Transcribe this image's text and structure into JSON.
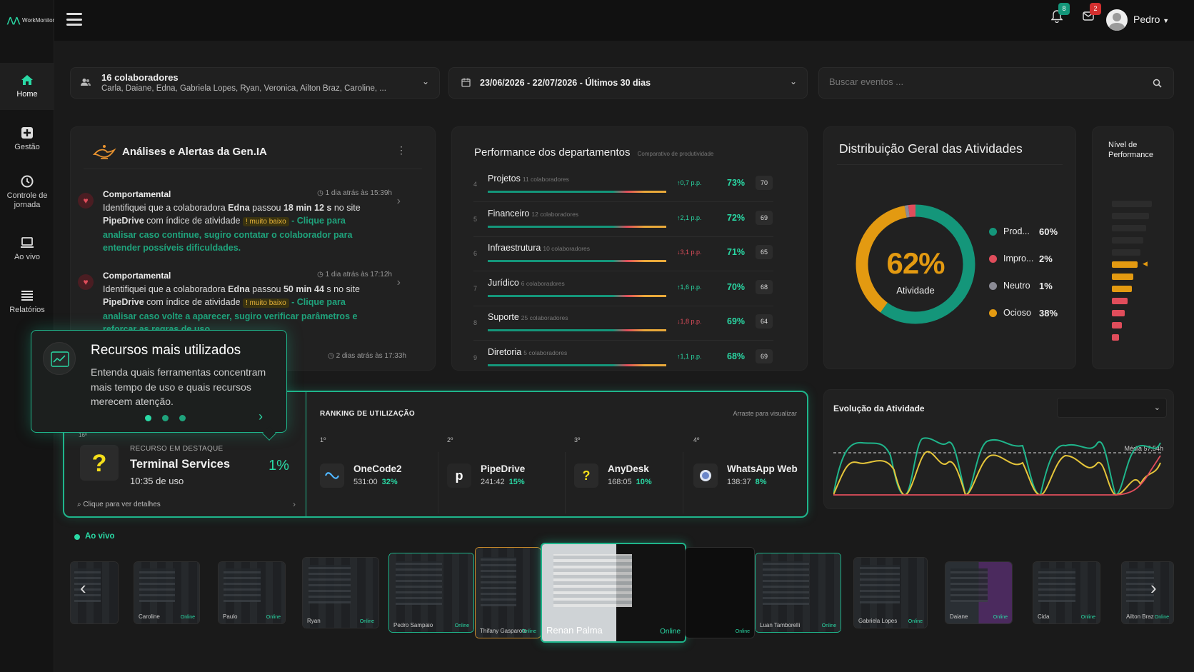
{
  "app": {
    "logo_text": "WorkMonitor"
  },
  "colors": {
    "accent": "#2ad9a5",
    "danger": "#e04d5b",
    "warning": "#e9a93a",
    "neutral": "#8b8b95"
  },
  "sidebar": {
    "items": [
      {
        "label": "Home",
        "icon": "home-icon"
      },
      {
        "label": "Gestão",
        "icon": "plus-square-icon"
      },
      {
        "label": "Controle de jornada",
        "icon": "clock-icon"
      },
      {
        "label": "Ao vivo",
        "icon": "monitor-icon"
      },
      {
        "label": "Relatórios",
        "icon": "list-icon"
      }
    ]
  },
  "header": {
    "notifications_count": "8",
    "messages_count": "2",
    "user_name": "Pedro"
  },
  "filters": {
    "collaborators_title": "16 colaboradores",
    "collaborators_names": "Carla, Daiane, Edna, Gabriela Lopes, Ryan, Veronica, Ailton Braz, Caroline, ...",
    "date_range": "23/06/2026 - 22/07/2026 - Últimos 30 dias",
    "search_placeholder": "Buscar eventos ..."
  },
  "alerts": {
    "title": "Análises e Alertas da Gen.IA",
    "items": [
      {
        "type": "Comportamental",
        "time": "1 dia atrás às 15:39h",
        "text_pre": "Identifiquei que a colaboradora ",
        "name": "Edna",
        "text_mid": " passou ",
        "duration": "18 min 12 s",
        "text_post": " no site",
        "site": "PipeDrive",
        "text_idx": " com índice de atividade ",
        "level": "muito baixo",
        "cta": " - Clique para analisar caso continue, sugiro contatar o colaborador para entender possíveis dificuldades."
      },
      {
        "type": "Comportamental",
        "time": "1 dia atrás às 17:12h",
        "text_pre": "Identifiquei que a colaboradora ",
        "name": "Edna",
        "text_mid": " passou ",
        "duration": "50 min 44",
        "text_post": " s no site",
        "site": "PipeDrive",
        "text_idx": " com índice de atividade ",
        "level": "muito baixo",
        "cta": " - Clique para analisar caso volte a aparecer, sugiro verificar parâmetros e reforçar as regras de uso."
      }
    ],
    "third_time": "2 dias atrás às 17:33h"
  },
  "tooltip": {
    "title": "Recursos mais utilizados",
    "text": "Entenda quais ferramentas concentram mais tempo de uso e quais recursos merecem atenção."
  },
  "departments": {
    "title": "Performance dos departamentos",
    "subtitle": "Comparativo de produtividade",
    "rows": [
      {
        "idx": "4",
        "name": "Projetos",
        "sub": "11 colaboradores",
        "change": "↑0,7 p.p.",
        "dir": "up",
        "pct": "73%",
        "score": "70"
      },
      {
        "idx": "5",
        "name": "Financeiro",
        "sub": "12 colaboradores",
        "change": "↑2,1 p.p.",
        "dir": "up",
        "pct": "72%",
        "score": "69"
      },
      {
        "idx": "6",
        "name": "Infraestrutura",
        "sub": "10 colaboradores",
        "change": "↓3,1 p.p.",
        "dir": "down",
        "pct": "71%",
        "score": "65"
      },
      {
        "idx": "7",
        "name": "Jurídico",
        "sub": "6 colaboradores",
        "change": "↑1,6 p.p.",
        "dir": "up",
        "pct": "70%",
        "score": "68"
      },
      {
        "idx": "8",
        "name": "Suporte",
        "sub": "25 colaboradores",
        "change": "↓1,8 p.p.",
        "dir": "down",
        "pct": "69%",
        "score": "64"
      },
      {
        "idx": "9",
        "name": "Diretoria",
        "sub": "5 colaboradores",
        "change": "↑1,1 p.p.",
        "dir": "up",
        "pct": "68%",
        "score": "69"
      }
    ]
  },
  "distribution": {
    "title": "Distribuição Geral das Atividades",
    "center_value": "62%",
    "center_label": "Atividade",
    "items": [
      {
        "label": "Prod...",
        "value": "60%",
        "color": "#14967a",
        "fraction": 0.6
      },
      {
        "label": "Impro...",
        "value": "2%",
        "color": "#e04d5b",
        "fraction": 0.02
      },
      {
        "label": "Neutro",
        "value": "1%",
        "color": "#8b8b95",
        "fraction": 0.01
      },
      {
        "label": "Ocioso",
        "value": "38%",
        "color": "#e39a11",
        "fraction": 0.37
      }
    ]
  },
  "performance_level": {
    "title": "Nível de Performance"
  },
  "featured": {
    "rank_label": "16º",
    "label": "RECURSO EM DESTAQUE",
    "name": "Terminal Services",
    "usage": "10:35 de uso",
    "pct": "1%",
    "details": "Clique para ver detalhes"
  },
  "ranking": {
    "title": "RANKING DE UTILIZAÇÃO",
    "hint": "Arraste para visualizar",
    "items": [
      {
        "pos": "1º",
        "name": "OneCode2",
        "time": "531:00",
        "pct": "32%",
        "icon": "onecode-icon"
      },
      {
        "pos": "2º",
        "name": "PipeDrive",
        "time": "241:42",
        "pct": "15%",
        "icon": "pipedrive-icon"
      },
      {
        "pos": "3º",
        "name": "AnyDesk",
        "time": "168:05",
        "pct": "10%",
        "icon": "question-icon"
      },
      {
        "pos": "4º",
        "name": "WhatsApp Web",
        "time": "138:37",
        "pct": "8%",
        "icon": "whatsapp-icon"
      }
    ]
  },
  "evolution": {
    "title": "Evolução da Atividade",
    "avg_label": "Média 57,54h"
  },
  "live": {
    "label": "Ao vivo",
    "online_label": "Online",
    "thumbs": [
      "",
      "Caroline",
      "Paulo",
      "Ryan",
      "Pedro Sampaio",
      "Thifany Gasparoto",
      "Renan Palma",
      "",
      "Luan Tamborelli",
      "Gabriela Lopes",
      "Daiane",
      "Cida",
      "Ailton Braz"
    ]
  }
}
